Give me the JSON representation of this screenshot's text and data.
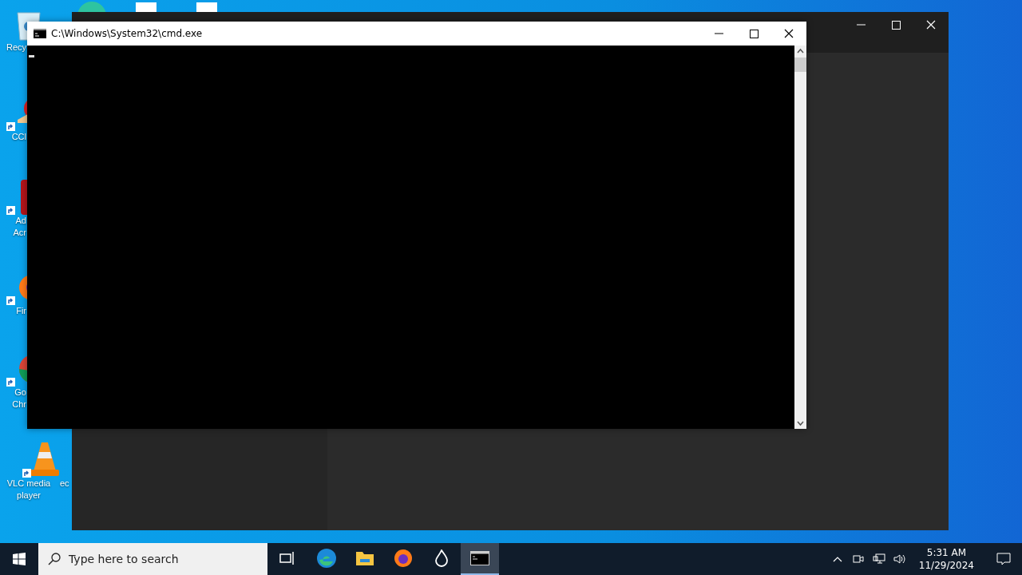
{
  "desktop": {
    "icons": [
      {
        "kind": "recycle-bin",
        "label_lines": [
          "Recy"
        ]
      },
      {
        "kind": "cleaner",
        "label_lines": [
          "CCl"
        ]
      },
      {
        "kind": "pdf",
        "label_lines": [
          "Ad",
          "Acr"
        ]
      },
      {
        "kind": "fox",
        "label_lines": [
          "Fir"
        ]
      },
      {
        "kind": "chrome",
        "label_lines": [
          "Go",
          "Chr"
        ]
      },
      {
        "kind": "cone",
        "label_lines": [
          "VLC media",
          "player"
        ]
      }
    ],
    "partial_label": "ec"
  },
  "console": {
    "title": "C:\\Windows\\System32\\cmd.exe"
  },
  "taskbar": {
    "search": {
      "placeholder": "Type here to search"
    },
    "apps": [
      {
        "kind": "task-view",
        "selected": false
      },
      {
        "kind": "edge",
        "selected": false
      },
      {
        "kind": "folder",
        "selected": false
      },
      {
        "kind": "fox",
        "selected": false
      },
      {
        "kind": "flame",
        "selected": false
      },
      {
        "kind": "terminal",
        "selected": true
      }
    ],
    "clock": {
      "time": "5:31 AM",
      "date": "11/29/2024"
    }
  }
}
